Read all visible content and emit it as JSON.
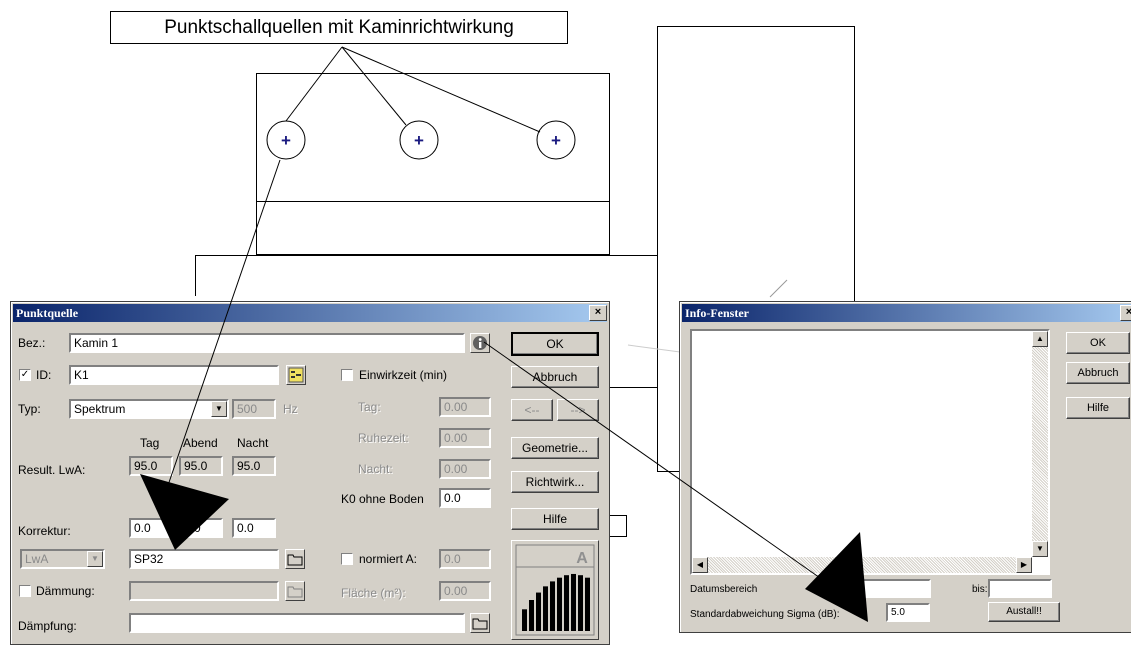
{
  "callout": {
    "text": "Punktschallquellen mit Kaminrichtwirkung"
  },
  "drawing": {
    "source_symbol": "+"
  },
  "punktquelle": {
    "title": "Punktquelle",
    "close": "×",
    "bez_label": "Bez.:",
    "bez_value": "Kamin 1",
    "id_check": "✓",
    "id_label": "ID:",
    "id_value": "K1",
    "einwirkzeit_label": "Einwirkzeit (min)",
    "typ_label": "Typ:",
    "typ_value": "Spektrum",
    "hz_value": "500",
    "hz_unit": "Hz",
    "tag_label": "Tag:",
    "tag_value": "0.00",
    "ruhezeit_label": "Ruhezeit:",
    "ruhezeit_value": "0.00",
    "nacht_label": "Nacht:",
    "nacht_value": "0.00",
    "col_tag": "Tag",
    "col_abend": "Abend",
    "col_nacht": "Nacht",
    "result_label": "Result. LwA:",
    "result_tag": "95.0",
    "result_abend": "95.0",
    "result_nacht": "95.0",
    "k0_label": "K0 ohne Boden",
    "k0_value": "0.0",
    "korrektur_label": "Korrektur:",
    "korr_tag": "0.0",
    "korr_abend": "0.0",
    "korr_nacht": "0.0",
    "lwa_select": "LwA",
    "spectrum_ref": "SP32",
    "normiert_label": "normiert A:",
    "normiert_value": "0.0",
    "daemmung_label": "Dämmung:",
    "flaeche_label": "Fläche (m²):",
    "flaeche_value": "0.00",
    "daempfung_label": "Dämpfung:",
    "buttons": {
      "ok": "OK",
      "abbruch": "Abbruch",
      "prev": "<--",
      "next": "-->",
      "geometrie": "Geometrie...",
      "richtwirk": "Richtwirk...",
      "hilfe": "Hilfe"
    },
    "spectrum_letter": "A",
    "spectrum_bars": [
      0.35,
      0.5,
      0.62,
      0.72,
      0.8,
      0.86,
      0.9,
      0.92,
      0.9,
      0.86
    ]
  },
  "info": {
    "title": "Info-Fenster",
    "close": "×",
    "buttons": {
      "ok": "OK",
      "abbruch": "Abbruch",
      "hilfe": "Hilfe"
    },
    "datumsbereich_label": "Datumsbereich",
    "datum_von": "",
    "bis_label": "bis:",
    "datum_bis": "",
    "sigma_label": "Standardabweichung Sigma (dB):",
    "sigma_value": "5.0",
    "austall_button": "Austall!!"
  }
}
